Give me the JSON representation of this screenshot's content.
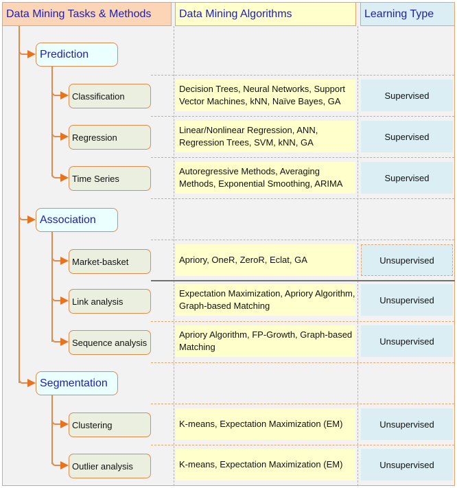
{
  "headers": {
    "tasks": "Data Mining Tasks & Methods",
    "algorithms": "Data Mining Algorithms",
    "learning_type": "Learning Type"
  },
  "categories": [
    {
      "name": "Prediction",
      "tasks": [
        {
          "name": "Classification",
          "algorithms": "Decision Trees, Neural Networks, Support Vector Machines, kNN, Naïve Bayes, GA",
          "learning_type": "Supervised"
        },
        {
          "name": "Regression",
          "algorithms": "Linear/Nonlinear Regression, ANN, Regression Trees, SVM, kNN, GA",
          "learning_type": "Supervised"
        },
        {
          "name": "Time Series",
          "algorithms": "Autoregressive Methods, Averaging Methods, Exponential Smoothing, ARIMA",
          "learning_type": "Supervised"
        }
      ]
    },
    {
      "name": "Association",
      "tasks": [
        {
          "name": "Market-basket",
          "algorithms": "Apriory, OneR, ZeroR, Eclat, GA",
          "learning_type": "Unsupervised"
        },
        {
          "name": "Link analysis",
          "algorithms": "Expectation Maximization, Apriory Algorithm, Graph-based Matching",
          "learning_type": "Unsupervised"
        },
        {
          "name": "Sequence analysis",
          "algorithms": "Apriory Algorithm, FP-Growth, Graph-based Matching",
          "learning_type": "Unsupervised"
        }
      ]
    },
    {
      "name": "Segmentation",
      "tasks": [
        {
          "name": "Clustering",
          "algorithms": "K-means, Expectation Maximization (EM)",
          "learning_type": "Unsupervised"
        },
        {
          "name": "Outlier analysis",
          "algorithms": "K-means, Expectation Maximization (EM)",
          "learning_type": "Unsupervised"
        }
      ]
    }
  ],
  "colors": {
    "border": "#e8a36a",
    "connector": "#e08a4c",
    "header_text": "#2020b0",
    "tasks_header_bg": "#fbd5b5",
    "algorithms_bg": "#ffffcc",
    "learning_type_bg": "#dbeef4",
    "category_bg": "#eaffff",
    "task_bg": "#ebefdf"
  }
}
